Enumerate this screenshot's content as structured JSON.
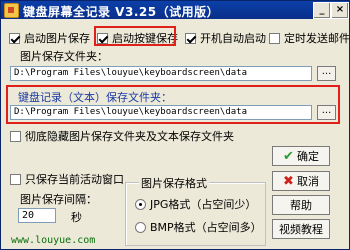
{
  "window": {
    "title": "键盘屏幕全记录 V3.25（试用版）",
    "minimize": "_",
    "close": "×"
  },
  "options_top": [
    {
      "label": "启动图片保存",
      "checked": true
    },
    {
      "label": "启动按键保存",
      "checked": true
    },
    {
      "label": "开机自动启动",
      "checked": true
    },
    {
      "label": "定时发送邮件",
      "checked": false
    }
  ],
  "image_folder": {
    "label": "图片保存文件夹：",
    "value": "D:\\Program Files\\louyue\\keyboardscreen\\data",
    "browse": "..."
  },
  "key_folder": {
    "label": "键盘记录（文本）保存文件夹：",
    "value": "D:\\Program Files\\louyue\\keyboardscreen\\data",
    "browse": "..."
  },
  "hide_folders": {
    "label": "彻底隐藏图片保存文件夹及文本保存文件夹",
    "checked": false
  },
  "active_window": {
    "label": "只保存当前活动窗口",
    "checked": false
  },
  "interval": {
    "label": "图片保存间隔：",
    "value": "20",
    "unit": "秒"
  },
  "format_group": {
    "title": "图片保存格式",
    "options": [
      {
        "label": "JPG格式（占空间少）",
        "selected": true
      },
      {
        "label": "BMP格式（占空间多）",
        "selected": false
      }
    ]
  },
  "buttons": {
    "ok": "确定",
    "cancel": "取消",
    "help": "帮助",
    "video": "视频教程"
  },
  "footer": {
    "url": "www.louyue.com"
  }
}
